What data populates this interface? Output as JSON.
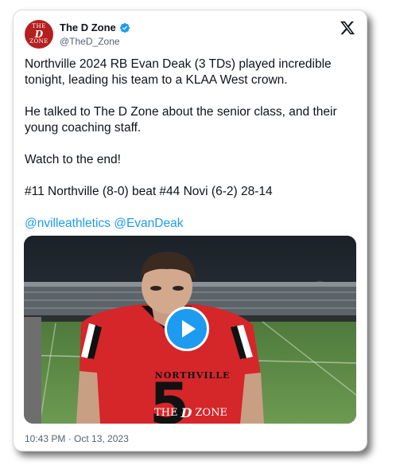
{
  "author": {
    "display_name": "The D Zone",
    "handle": "@TheD_Zone",
    "avatar_text_top": "THE",
    "avatar_text_mid": "D",
    "avatar_text_bottom": "ZONE",
    "verified": true
  },
  "tweet": {
    "paragraphs": [
      "Northville 2024 RB Evan Deak (3 TDs) played incredible tonight, leading his team to a KLAA West crown.",
      "He talked to The D Zone about the senior class, and their young coaching staff.",
      "Watch to the end!",
      "#11 Northville (8-0) beat #44 Novi (6-2) 28-14"
    ],
    "mentions": [
      "@nvilleathletics",
      "@EvanDeak"
    ]
  },
  "media": {
    "jersey_text": "NORTHVILLE",
    "watermark_left": "THE",
    "watermark_right": "ZONE",
    "watermark_mid": "D"
  },
  "timestamp": "10:43 PM · Oct 13, 2023",
  "colors": {
    "link": "#1d9bf0",
    "verified": "#1d9bf0",
    "brand_red": "#b3201f",
    "muted": "#536471"
  },
  "icons": {
    "platform_logo": "x-logo-icon",
    "verified": "verified-badge-icon",
    "play": "play-icon"
  }
}
